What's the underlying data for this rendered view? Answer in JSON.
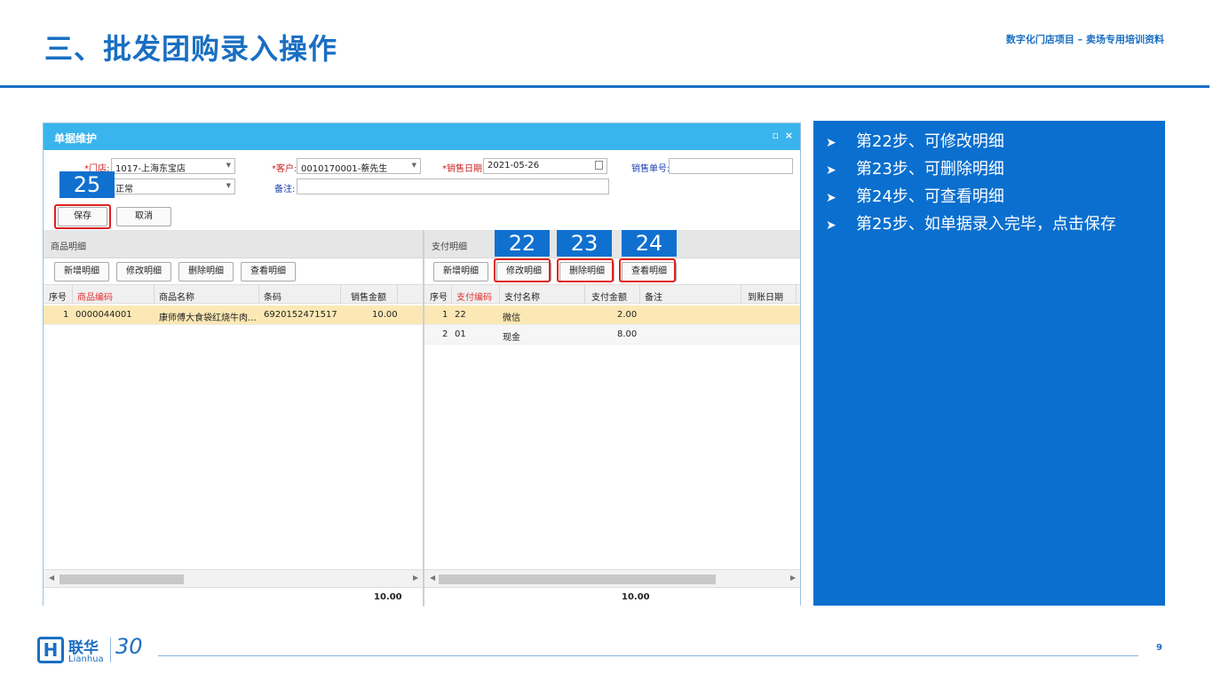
{
  "slide": {
    "title": "三、批发团购录入操作",
    "subtitle": "数字化门店项目 – 卖场专用培训资料",
    "page_number": "9"
  },
  "window": {
    "title": "单据维护",
    "min_icon": "minimize-icon",
    "close_label": "×"
  },
  "form": {
    "store_label": "*门店:",
    "store_value": "1017-上海东宝店",
    "customer_label": "*客户:",
    "customer_value": "0010170001-蔡先生",
    "date_label": "*销售日期:",
    "date_value": "2021-05-26",
    "order_no_label": "销售单号:",
    "order_no_value": "",
    "status_value": "正常",
    "remark_label": "备注:",
    "remark_value": ""
  },
  "actions": {
    "save": "保存",
    "cancel": "取消"
  },
  "steps": {
    "s22": "22",
    "s23": "23",
    "s24": "24",
    "s25": "25"
  },
  "goods": {
    "title": "商品明细",
    "buttons": {
      "add": "新增明细",
      "edit": "修改明细",
      "delete": "删除明细",
      "view": "查看明细"
    },
    "columns": [
      "序号",
      "商品编码",
      "商品名称",
      "条码",
      "销售金额"
    ],
    "rows": [
      {
        "no": "1",
        "code": "0000044001",
        "name": "康师傅大食袋红烧牛肉…",
        "barcode": "6920152471517",
        "amount": "10.00"
      }
    ],
    "total": "10.00"
  },
  "payment": {
    "title": "支付明细",
    "buttons": {
      "add": "新增明细",
      "edit": "修改明细",
      "delete": "删除明细",
      "view": "查看明细"
    },
    "columns": [
      "序号",
      "支付编码",
      "支付名称",
      "支付金额",
      "备注",
      "到账日期"
    ],
    "rows": [
      {
        "no": "1",
        "code": "22",
        "name": "微信",
        "amount": "2.00"
      },
      {
        "no": "2",
        "code": "01",
        "name": "现金",
        "amount": "8.00"
      }
    ],
    "total": "10.00"
  },
  "notes": [
    "第22步、可修改明细",
    "第23步、可删除明细",
    "第24步、可查看明细",
    "第25步、如单据录入完毕，点击保存"
  ],
  "logo": {
    "mark": "H",
    "cn": "联华",
    "en": "Lianhua",
    "anniversary": "30"
  },
  "colors": {
    "brand_blue": "#1a6fc2",
    "titlebar": "#3ab4ec",
    "notes_bg": "#0a6fce",
    "highlight_red": "#e02020",
    "selected_row": "#fbe8b4"
  }
}
